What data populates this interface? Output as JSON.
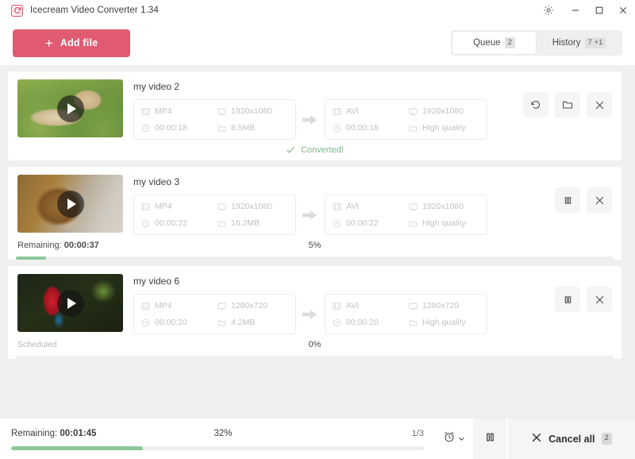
{
  "window": {
    "title": "Icecream Video Converter 1.34",
    "logo_icon": "refresh-circle-icon",
    "settings_icon": "gear-icon",
    "minimize_icon": "minimize-icon",
    "maximize_icon": "maximize-icon",
    "close_icon": "close-icon"
  },
  "toolbar": {
    "add_file_label": "Add file",
    "add_file_icon": "plus-icon",
    "tabs": [
      {
        "label": "Queue",
        "badge": "2",
        "active": true
      },
      {
        "label": "History",
        "badge": "7",
        "badge_extra": "+1",
        "active": false
      }
    ]
  },
  "queue": {
    "items": [
      {
        "name": "my video 2",
        "thumb_art": "cheetah",
        "play_icon": "play-icon",
        "source": {
          "format": "MP4",
          "resolution": "1920x1080",
          "duration": "00:00:18",
          "size": "8.5MB"
        },
        "target": {
          "format": "AVI",
          "resolution": "1920x1080",
          "duration": "00:00:18",
          "size": "High quality"
        },
        "status_text": "Converted!",
        "status_icon": "check-icon",
        "actions": [
          "restore-icon",
          "folder-icon",
          "close-icon"
        ]
      },
      {
        "name": "my video 3",
        "thumb_art": "lion",
        "play_icon": "play-icon",
        "source": {
          "format": "MP4",
          "resolution": "1920x1080",
          "duration": "00:00:22",
          "size": "16.2MB"
        },
        "target": {
          "format": "AVI",
          "resolution": "1920x1080",
          "duration": "00:00:22",
          "size": "High quality"
        },
        "remaining_label": "Remaining:",
        "remaining_value": "00:00:37",
        "percent_text": "5%",
        "percent_value": 5,
        "actions": [
          "pause-icon",
          "close-icon"
        ]
      },
      {
        "name": "my video 6",
        "thumb_art": "parrot",
        "play_icon": "play-icon",
        "source": {
          "format": "MP4",
          "resolution": "1280x720",
          "duration": "00:00:20",
          "size": "4.2MB"
        },
        "target": {
          "format": "AVI",
          "resolution": "1280x720",
          "duration": "00:00:20",
          "size": "High quality"
        },
        "scheduled_label": "Scheduled",
        "percent_text": "0%",
        "percent_value": 0,
        "actions": [
          "pause-icon",
          "close-icon"
        ]
      }
    ]
  },
  "bottom": {
    "remaining_label": "Remaining:",
    "remaining_value": "00:01:45",
    "percent_text": "32%",
    "percent_value": 32,
    "count_text": "1/3",
    "timer_icon": "alarm-clock-icon",
    "timer_chevron_icon": "chevron-down-icon",
    "pause_icon": "pause-icon",
    "cancel_icon": "close-icon",
    "cancel_label": "Cancel all",
    "cancel_badge": "2"
  },
  "colors": {
    "accent": "#e05a72",
    "progress": "#8cc79b",
    "success_text": "#7fb98c",
    "window_bg": "#f0f0f0"
  }
}
